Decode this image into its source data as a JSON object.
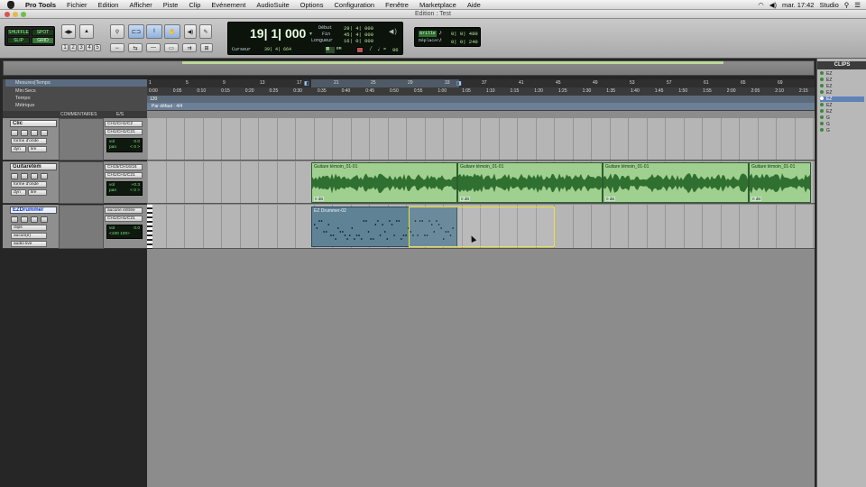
{
  "menubar": {
    "app": "Pro Tools",
    "items": [
      "Fichier",
      "Edition",
      "Afficher",
      "Piste",
      "Clip",
      "Evénement",
      "AudioSuite",
      "Options",
      "Configuration",
      "Fenêtre",
      "Marketplace",
      "Aide"
    ],
    "clock": "mar. 17:42",
    "user": "Studio"
  },
  "window": {
    "title": "Edition : Test"
  },
  "toolbar": {
    "modes": [
      "SHUFFLE",
      "SPOT",
      "SLIP",
      "GRID"
    ],
    "zoom_presets": [
      "1",
      "2",
      "3",
      "4",
      "5"
    ],
    "counter": {
      "main": "19| 1| 000",
      "cursor_label": "Curseur",
      "cursor_value": "39| 4| 664",
      "start_label": "Début",
      "start_value": "29| 4| 000",
      "end_label": "Fin",
      "end_value": "45| 4| 000",
      "length_label": "Longueur",
      "length_value": "16| 0| 000",
      "bpm": "96"
    },
    "grid": {
      "label": "Grille",
      "value": "0| 0| 480"
    },
    "nudge": {
      "label": "Déplacer",
      "value": "0| 0| 240"
    }
  },
  "rulers": {
    "labels": [
      "Mesures|Temps",
      "Min:Secs",
      "Tempo",
      "Métrique"
    ],
    "bars": [
      "1",
      "5",
      "9",
      "13",
      "17",
      "21",
      "25",
      "29",
      "33",
      "37",
      "41",
      "45",
      "49",
      "53",
      "57",
      "61",
      "65",
      "69"
    ],
    "minsecs": [
      "0:00",
      "0:05",
      "0:10",
      "0:15",
      "0:20",
      "0:25",
      "0:30",
      "0:35",
      "0:40",
      "0:45",
      "0:50",
      "0:55",
      "1:00",
      "1:05",
      "1:10",
      "1:15",
      "1:20",
      "1:25",
      "1:30",
      "1:35",
      "1:40",
      "1:45",
      "1:50",
      "1:55",
      "2:00",
      "2:05",
      "2:10",
      "2:15"
    ],
    "tempo_value": "120",
    "meter_value": "Par défaut : 4/4"
  },
  "track_columns": {
    "comments": "COMMENTAIRES",
    "io": "E/S"
  },
  "tracks": [
    {
      "name": "Clic",
      "view": "forme d'onde",
      "mode": "dyn",
      "mode2": "lire",
      "io_in": "CH1/CH1/C2",
      "io_out": "CH1/CH1/C21",
      "vol_label": "vol",
      "vol": "0.0",
      "pan_label": "pan",
      "pan": "< 0 >"
    },
    {
      "name": "Guitaretém",
      "view": "forme d'onde",
      "mode": "dyn",
      "mode2": "lire",
      "io_in": "CH15/CH16/16",
      "io_out": "CH1/CH1/C21",
      "vol_label": "vol",
      "vol": "+0.3",
      "pan_label": "pan",
      "pan": "< 0 >",
      "clips": [
        {
          "name": "Guitare témoin_01-01",
          "gain": "0 dB"
        },
        {
          "name": "Guitare témoin_01-01",
          "gain": "0 dB"
        },
        {
          "name": "Guitare témoin_01-01",
          "gain": "0 dB"
        },
        {
          "name": "Guitare témoin_01-01",
          "gain": "0 dB"
        }
      ]
    },
    {
      "name": "EZDrummer",
      "view": "clips",
      "mode": "aucun(e)",
      "mode2": "audio live",
      "io_in": "aucune entrée",
      "io_out": "CH1/CH1/C21",
      "vol_label": "vol",
      "vol": "0.0",
      "pan_label": "pan",
      "pan": "<100  100>",
      "clips": [
        {
          "name": "EZ Drummer-02"
        }
      ]
    }
  ],
  "clips_panel": {
    "title": "CLIPS",
    "items": [
      "EZ",
      "EZ",
      "EZ",
      "EZ",
      "EZ",
      "EZ",
      "EZ",
      "G",
      "G",
      "G"
    ]
  },
  "colors": {
    "audio_clip": "#9fd090",
    "midi_clip": "#5f8294",
    "selection": "#e8e23a",
    "lcd_text": "#bfe6a0"
  }
}
